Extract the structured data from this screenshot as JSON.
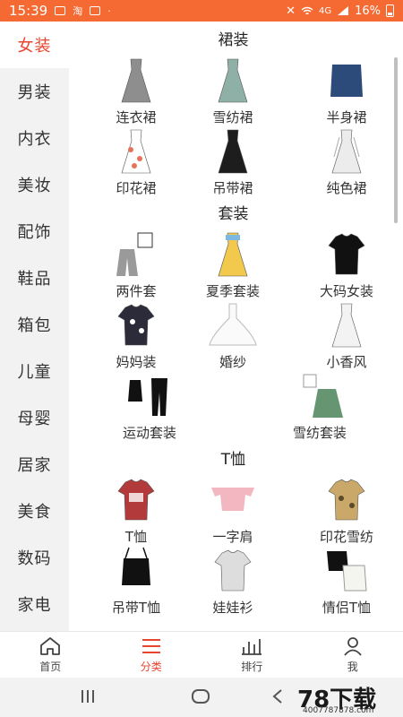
{
  "status_bar": {
    "time": "15:39",
    "signal_text": "4G",
    "battery": "16%",
    "battery_level": 0.16
  },
  "sidebar": {
    "items": [
      {
        "label": "女装",
        "active": true
      },
      {
        "label": "男装"
      },
      {
        "label": "内衣"
      },
      {
        "label": "美妆"
      },
      {
        "label": "配饰"
      },
      {
        "label": "鞋品"
      },
      {
        "label": "箱包"
      },
      {
        "label": "儿童"
      },
      {
        "label": "母婴"
      },
      {
        "label": "居家"
      },
      {
        "label": "美食"
      },
      {
        "label": "数码"
      },
      {
        "label": "家电"
      }
    ]
  },
  "sections": [
    {
      "title": "裙装",
      "items": [
        {
          "label": "连衣裙",
          "icon": "gray-plaid-dress",
          "color": "#8e8e8e"
        },
        {
          "label": "雪纺裙",
          "icon": "floral-chiffon-dress",
          "color": "#8fb0a6"
        },
        {
          "label": "半身裙",
          "icon": "denim-skirt",
          "color": "#2c4a7a"
        },
        {
          "label": "印花裙",
          "icon": "print-dress",
          "color": "#e5735a"
        },
        {
          "label": "吊带裙",
          "icon": "black-slip-dress",
          "color": "#1d1d1d"
        },
        {
          "label": "纯色裙",
          "icon": "white-shirt-dress",
          "color": "#ececec"
        }
      ]
    },
    {
      "title": "套装",
      "items": [
        {
          "label": "两件套",
          "icon": "two-piece-set",
          "color": "#9a9a9a"
        },
        {
          "label": "夏季套装",
          "icon": "summer-set",
          "color": "#f2c94c"
        },
        {
          "label": "大码女装",
          "icon": "black-tshirt",
          "color": "#111111"
        },
        {
          "label": "妈妈装",
          "icon": "mom-floral-top",
          "color": "#2b2b3a"
        },
        {
          "label": "婚纱",
          "icon": "wedding-dress",
          "color": "#f6f6f6"
        },
        {
          "label": "小香风",
          "icon": "white-tweed-dress",
          "color": "#f3f3f3"
        },
        {
          "label": "运动套装",
          "icon": "sport-set",
          "color": "#111111"
        },
        {
          "label": "雪纺套装",
          "icon": "chiffon-set",
          "color": "#3f7a4e"
        }
      ]
    },
    {
      "title": "T恤",
      "items": [
        {
          "label": "T恤",
          "icon": "red-graphic-tee",
          "color": "#b23a3a"
        },
        {
          "label": "一字肩",
          "icon": "pink-off-shoulder",
          "color": "#f2b7c0"
        },
        {
          "label": "印花雪纺",
          "icon": "print-chiffon-top",
          "color": "#c9a86a"
        },
        {
          "label": "吊带T恤",
          "icon": "black-cami",
          "color": "#111111"
        },
        {
          "label": "娃娃衫",
          "icon": "doll-shirt",
          "color": "#dddddd"
        },
        {
          "label": "情侣T恤",
          "icon": "couple-tee",
          "color": "#111111"
        }
      ]
    }
  ],
  "tab_bar": {
    "tabs": [
      {
        "label": "首页",
        "icon": "home-icon"
      },
      {
        "label": "分类",
        "icon": "menu-icon",
        "active": true
      },
      {
        "label": "排行",
        "icon": "bar-chart-icon"
      },
      {
        "label": "我",
        "icon": "person-icon"
      }
    ]
  },
  "watermark": {
    "logo": "78下载",
    "url": "4007787878.com"
  }
}
